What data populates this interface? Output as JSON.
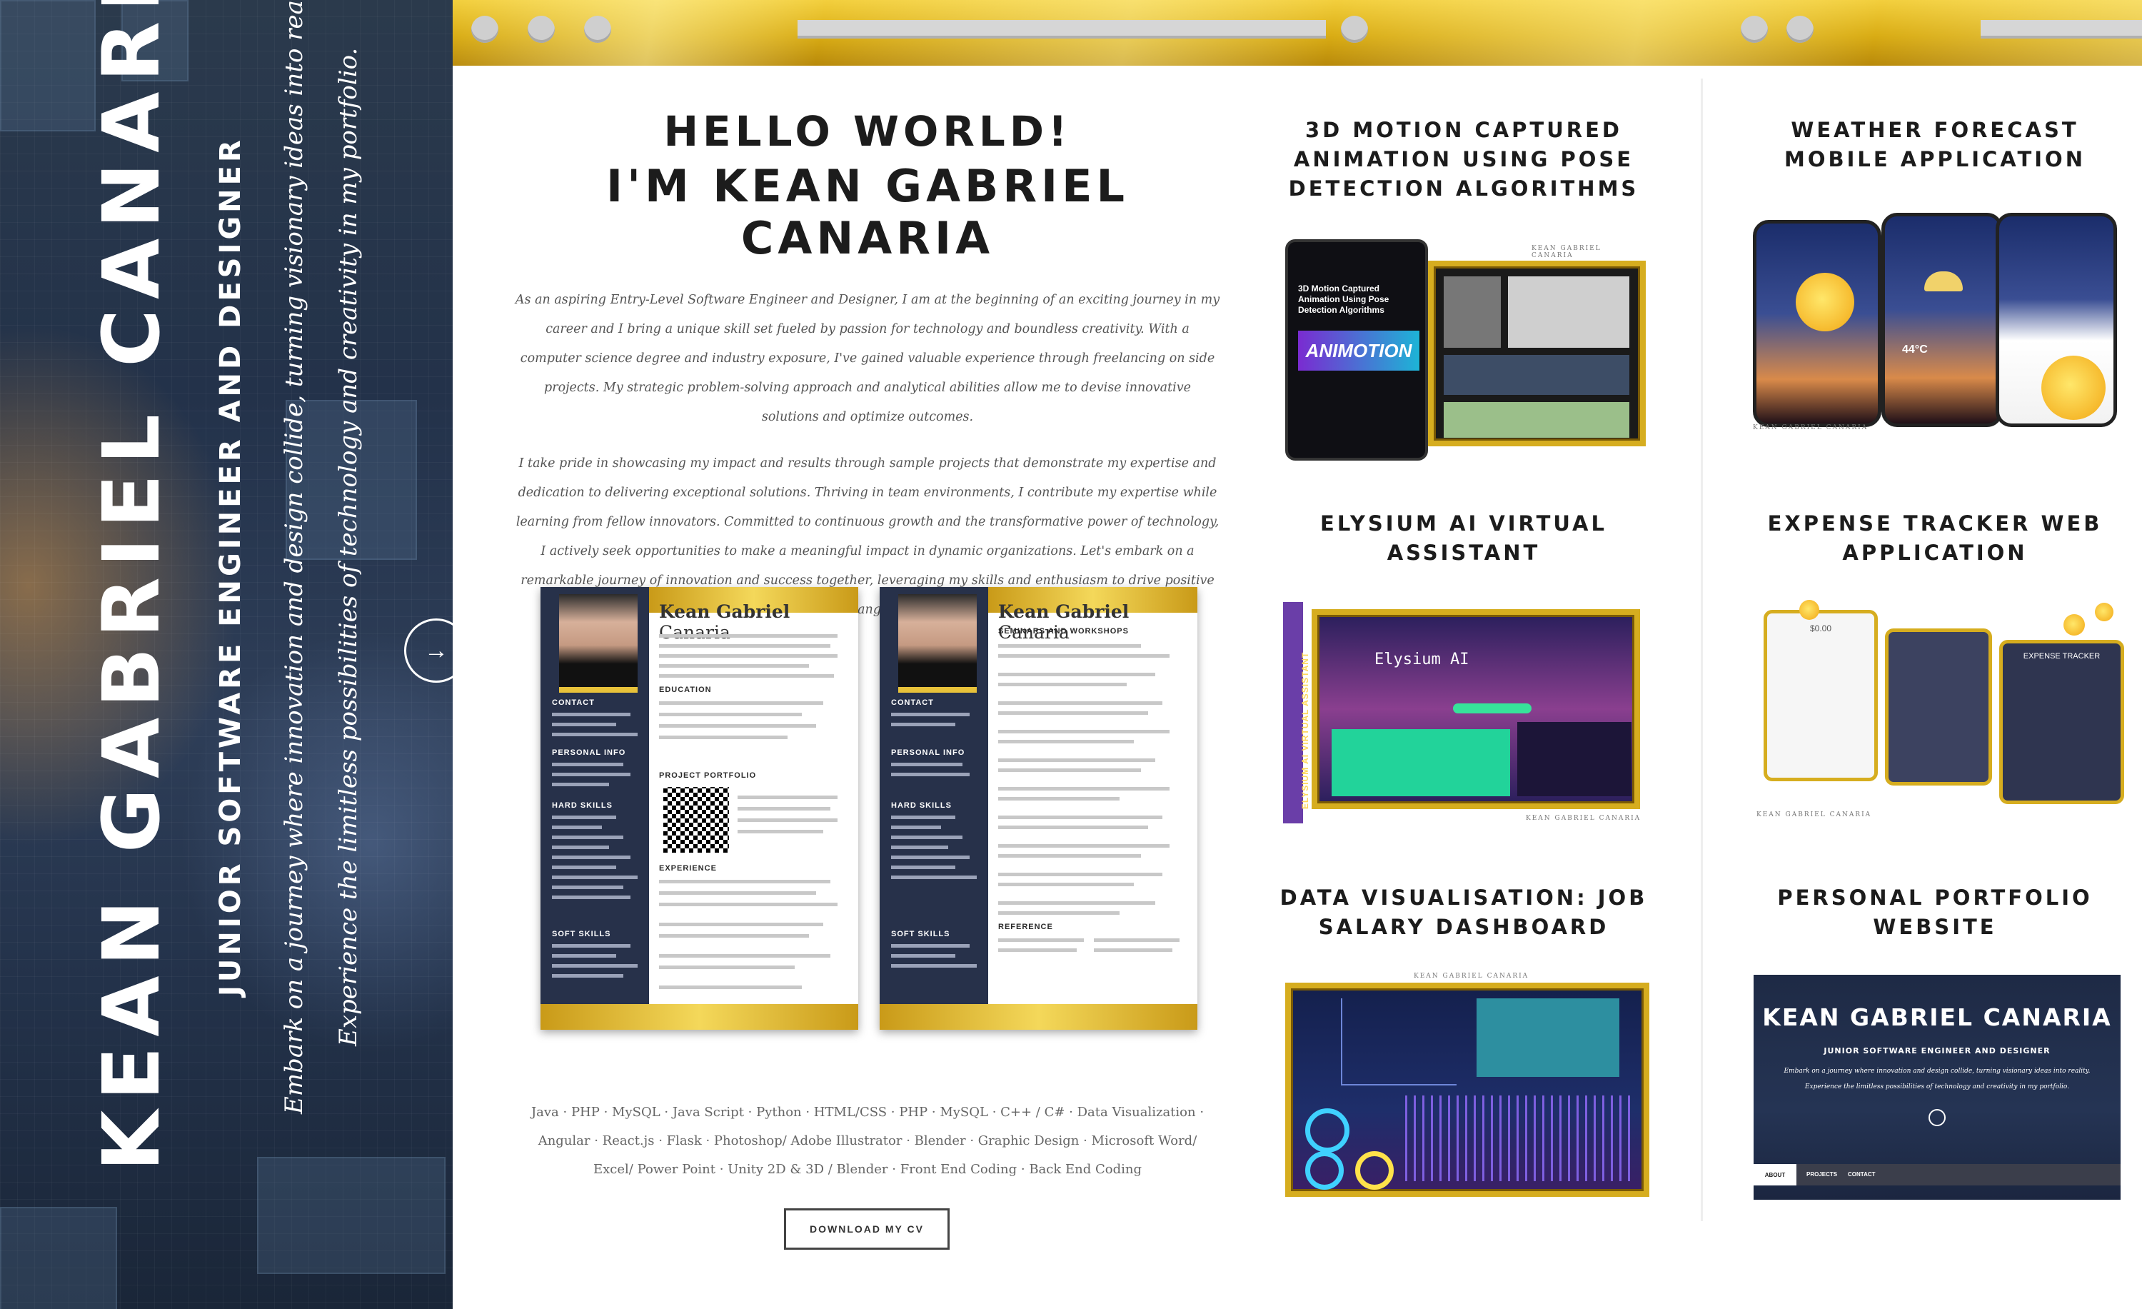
{
  "hero": {
    "name": "KEAN GABRIEL CANARIA",
    "role": "JUNIOR SOFTWARE ENGINEER AND DESIGNER",
    "tagline_1": "Embark on a journey where innovation and design collide, turning visionary ideas into reality.",
    "tagline_2": "Experience the limitless possibilities of technology and creativity in my portfolio.",
    "arrow_glyph": "→"
  },
  "intro": {
    "title_line1": "HELLO WORLD!",
    "title_line2": "I'M KEAN GABRIEL CANARIA",
    "paragraph_1": "As an aspiring Entry-Level Software Engineer and Designer, I am at the beginning of an exciting journey in my career and I bring a unique skill set fueled by passion for technology and boundless creativity. With a computer science degree and industry exposure, I've gained valuable experience through freelancing on side projects. My strategic problem-solving approach and analytical abilities allow me to devise innovative solutions and optimize outcomes.",
    "paragraph_2": "I take pride in showcasing my impact and results through sample projects that demonstrate my expertise and dedication to delivering exceptional solutions. Thriving in team environments, I contribute my expertise while learning from fellow innovators. Committed to continuous growth and the transformative power of technology, I actively seek opportunities to make a meaningful impact in dynamic organizations. Let's embark on a remarkable journey of innovation and success together, leveraging my skills and enthusiasm to drive positive change.",
    "skills": "Java · PHP · MySQL · Java Script · Python · HTML/CSS · PHP · MySQL · C++ / C# · Data Visualization · Angular · React.js · Flask · Photoshop/ Adobe Illustrator · Blender · Graphic Design · Microsoft Word/ Excel/ Power Point · Unity 2D & 3D / Blender · Front End Coding · Back End Coding",
    "download_label": "DOWNLOAD MY CV"
  },
  "cv_pages": [
    {
      "first": "Kean Gabriel",
      "last": "Canaria",
      "section_a": "EDUCATION",
      "section_b": "PROJECT PORTFOLIO",
      "section_c": "EXPERIENCE",
      "side_a": "CONTACT",
      "side_b": "PERSONAL INFO",
      "side_c": "HARD SKILLS",
      "side_d": "SOFT SKILLS"
    },
    {
      "first": "Kean Gabriel",
      "last": "Canaria",
      "section_a": "SEMINARS AND WORKSHOPS",
      "section_b": "REFERENCE",
      "side_a": "CONTACT",
      "side_b": "PERSONAL INFO",
      "side_c": "HARD SKILLS",
      "side_d": "SOFT SKILLS"
    }
  ],
  "projects": [
    {
      "title": "3D MOTION CAPTURED ANIMATION USING POSE DETECTION ALGORITHMS",
      "thumb_text": "ANIMOTION",
      "thumb_sub": "3D Motion Captured Animation Using Pose Detection Algorithms"
    },
    {
      "title": "WEATHER FORECAST MOBILE APPLICATION",
      "thumb_text": "44°C"
    },
    {
      "title": "ELYSIUM AI VIRTUAL ASSISTANT",
      "thumb_text": "Elysium AI",
      "thumb_side": "ELYSIUM AI VIRTUAL ASSISTANT"
    },
    {
      "title": "EXPENSE TRACKER WEB APPLICATION",
      "thumb_text": "EXPENSE TRACKER",
      "thumb_value": "$0.00"
    },
    {
      "title": "DATA VISUALISATION: JOB SALARY DASHBOARD"
    },
    {
      "title": "PERSONAL PORTFOLIO WEBSITE",
      "thumb_name": "KEAN GABRIEL CANARIA",
      "thumb_role": "JUNIOR SOFTWARE ENGINEER AND DESIGNER",
      "thumb_tag1": "Embark on a journey where innovation and design collide, turning visionary ideas into reality.",
      "thumb_tag2": "Experience the limitless possibilities of technology and creativity in my portfolio.",
      "thumb_nav": [
        "ABOUT",
        "PROJECTS",
        "CONTACT"
      ]
    }
  ],
  "watermark": "KEAN GABRIEL CANARIA",
  "colors": {
    "gold": "#d6ad1f",
    "hero_bg": "#23324a",
    "text_dark": "#1c1c1c"
  }
}
